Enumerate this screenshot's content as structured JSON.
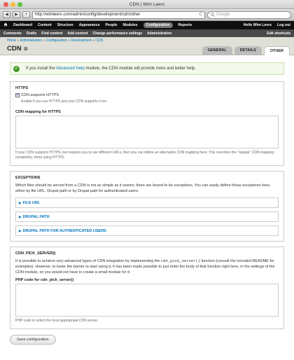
{
  "window": {
    "title": "CDN | Wim Leers",
    "back": "◀",
    "forward": "▶",
    "add": "+",
    "url": "http://wimleers.com/admin/config/development/cdn/other",
    "reload": "C",
    "search_placeholder": "Google",
    "traffic_colors": [
      "#ec5f57",
      "#f5be3f",
      "#5fc43f"
    ]
  },
  "toolbar": {
    "home_icon": "home-icon",
    "items": [
      "Dashboard",
      "Content",
      "Structure",
      "Appearance",
      "People",
      "Modules",
      "Configuration",
      "Reports"
    ],
    "active": "Configuration",
    "user": "Hello Wim Leers",
    "logout": "Log out"
  },
  "shortcuts": {
    "items": [
      "Comments",
      "Drafts",
      "Find content",
      "Add content",
      "Change performance settings",
      "Administration"
    ],
    "edit": "Edit shortcuts"
  },
  "header": {
    "breadcrumb": [
      "Home",
      "Administration",
      "Configuration",
      "Development",
      "CDN"
    ],
    "breadcrumb_sep": "»",
    "title": "CDN",
    "gear": "⚙",
    "tabs": [
      "GENERAL",
      "DETAILS",
      "OTHER"
    ],
    "active_tab": "OTHER"
  },
  "message": {
    "prefix": "If you install the ",
    "link": "Advanced Help",
    "suffix": " module, the CDN module will provide more and better help."
  },
  "https": {
    "legend": "HTTPS",
    "checkbox_label": "CDN supports HTTPS",
    "checkbox_checked": true,
    "checkbox_desc": "Enable if you use HTTPS and your CDN supports it too.",
    "mapping_label": "CDN mapping for HTTPS",
    "mapping_value": "",
    "mapping_help": "If your CDN supports HTTPS, but requires you to use different URLs, then you can define an alternative CDN mapping here. This overrides the \"regular\" CDN mapping completely, when using HTTPS."
  },
  "exceptions": {
    "legend": "EXCEPTIONS",
    "body": "Which files should be served from a CDN is not as simple as it seems: there are bound to be exceptions. You can easily define those exceptions here, either by file URL, Drupal path or by Drupal path for authenticated users.",
    "groups": [
      "FILE URL",
      "DRUPAL PATH",
      "DRUPAL PATH FOR AUTHENTICATED USERS"
    ]
  },
  "pick_server": {
    "legend": "CDN_PICK_SERVER()",
    "body_1": "It is possible to achieve very advanced types of CDN integration by implementing the ",
    "code": "cdn_pick_server()",
    "body_2": " function (consult the included README for examples). However, to lower the barrier to start using it, it has been made possible to just enter the body of that function right here, in the settings of the CDN module, so you would not have to create a small module for it.",
    "php_label": "PHP code for cdn_pick_server()",
    "php_value": "",
    "php_help": "PHP code to select the most appropriate CDN server."
  },
  "actions": {
    "save": "Save configuration"
  }
}
